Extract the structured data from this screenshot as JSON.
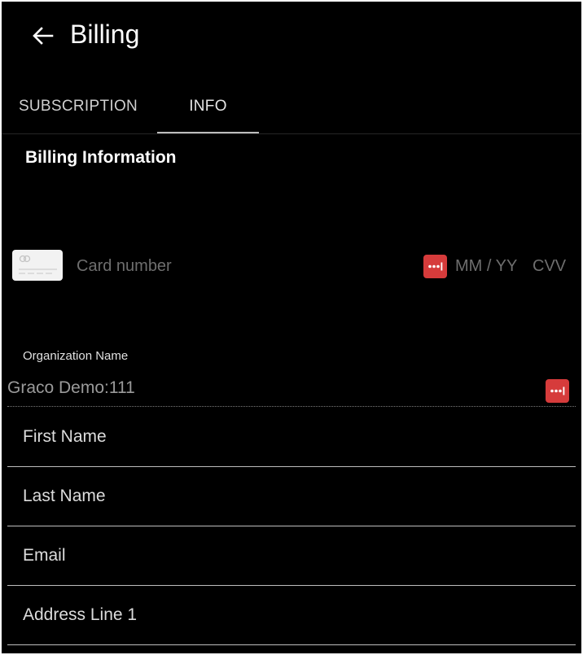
{
  "header": {
    "title": "Billing",
    "back_icon": "arrow-left-icon"
  },
  "tabs": [
    {
      "label": "SUBSCRIPTION",
      "active": false
    },
    {
      "label": "INFO",
      "active": true
    }
  ],
  "section": {
    "title": "Billing Information"
  },
  "card": {
    "number_placeholder": "Card number",
    "expiry_placeholder": "MM / YY",
    "cvv_placeholder": "CVV",
    "card_icon": "credit-card-icon",
    "password_manager_icon": "password-manager-icon"
  },
  "organization": {
    "label": "Organization Name",
    "value": "Graco Demo:111"
  },
  "fields": {
    "first_name": "First Name",
    "last_name": "Last Name",
    "email": "Email",
    "address_line_1": "Address Line 1"
  },
  "colors": {
    "background": "#000000",
    "password_manager_red": "#d63b3b",
    "text_primary": "#ffffff",
    "text_muted": "#6e6e6e"
  }
}
